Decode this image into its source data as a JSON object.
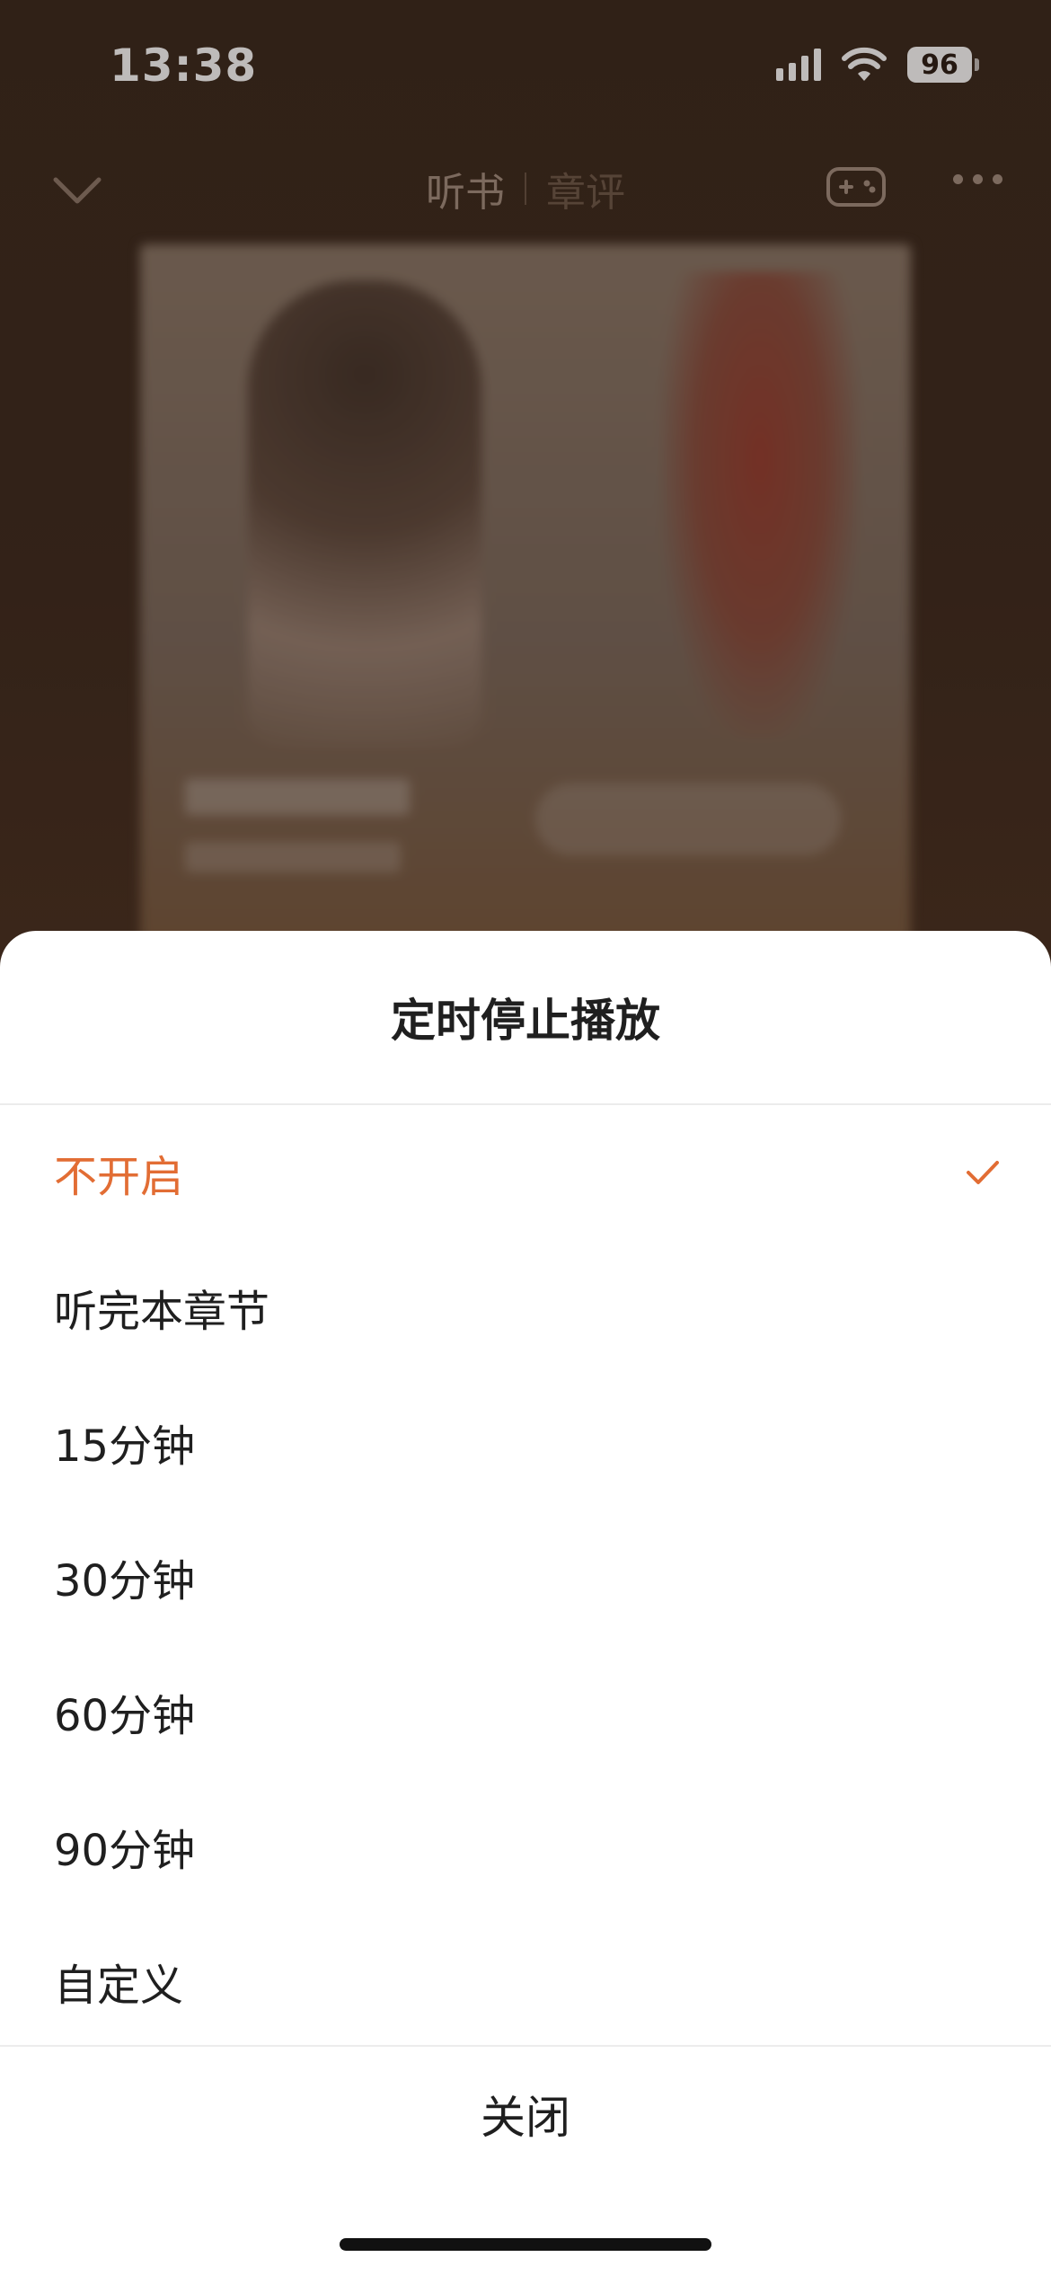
{
  "status_bar": {
    "time": "13:38",
    "battery": "96",
    "signal_icon": "cellular-signal-icon",
    "wifi_icon": "wifi-icon"
  },
  "nav": {
    "back_icon": "chevron-down-icon",
    "tabs": [
      "听书",
      "章评"
    ],
    "game_icon": "gamepad-icon",
    "more_icon": "more-dots-icon"
  },
  "sheet": {
    "title": "定时停止播放",
    "options": [
      {
        "label": "不开启",
        "selected": true
      },
      {
        "label": "听完本章节",
        "selected": false
      },
      {
        "label": "15分钟",
        "selected": false
      },
      {
        "label": "30分钟",
        "selected": false
      },
      {
        "label": "60分钟",
        "selected": false
      },
      {
        "label": "90分钟",
        "selected": false
      },
      {
        "label": "自定义",
        "selected": false
      }
    ],
    "close_label": "关闭",
    "accent_color": "#e26d34"
  }
}
